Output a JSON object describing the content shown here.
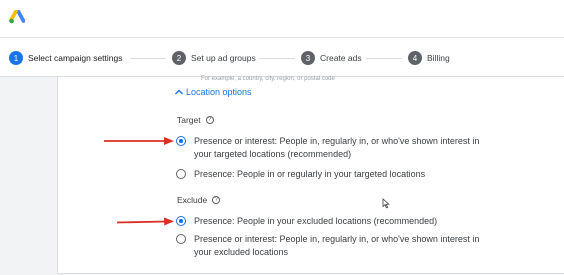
{
  "brand": {
    "logo_icon": "google-ads-logo-icon",
    "colors": [
      "#fbbc04",
      "#4285f4",
      "#34a853"
    ]
  },
  "stepper": {
    "steps": [
      {
        "number": "1",
        "label": "Select campaign settings",
        "active": true
      },
      {
        "number": "2",
        "label": "Set up ad groups",
        "active": false
      },
      {
        "number": "3",
        "label": "Create ads",
        "active": false
      },
      {
        "number": "4",
        "label": "Billing",
        "active": false
      }
    ]
  },
  "settings": {
    "faded_text": "For example, a country, city, region, or postal code",
    "location_options_label": "Location options",
    "target": {
      "title": "Target",
      "options": [
        {
          "line1": "Presence or interest: People in, regularly in, or who've shown interest in",
          "line2": "your targeted locations (recommended)",
          "selected": true
        },
        {
          "line1": "Presence: People in or regularly in your targeted locations",
          "selected": false
        }
      ]
    },
    "exclude": {
      "title": "Exclude",
      "options": [
        {
          "line1": "Presence: People in your excluded locations (recommended)",
          "selected": true
        },
        {
          "line1": "Presence or interest: People in, regularly in, or who've shown interest in",
          "line2": "your excluded locations",
          "selected": false
        }
      ]
    }
  },
  "annotation_color": "#d93025",
  "accent_color": "#1a73e8"
}
